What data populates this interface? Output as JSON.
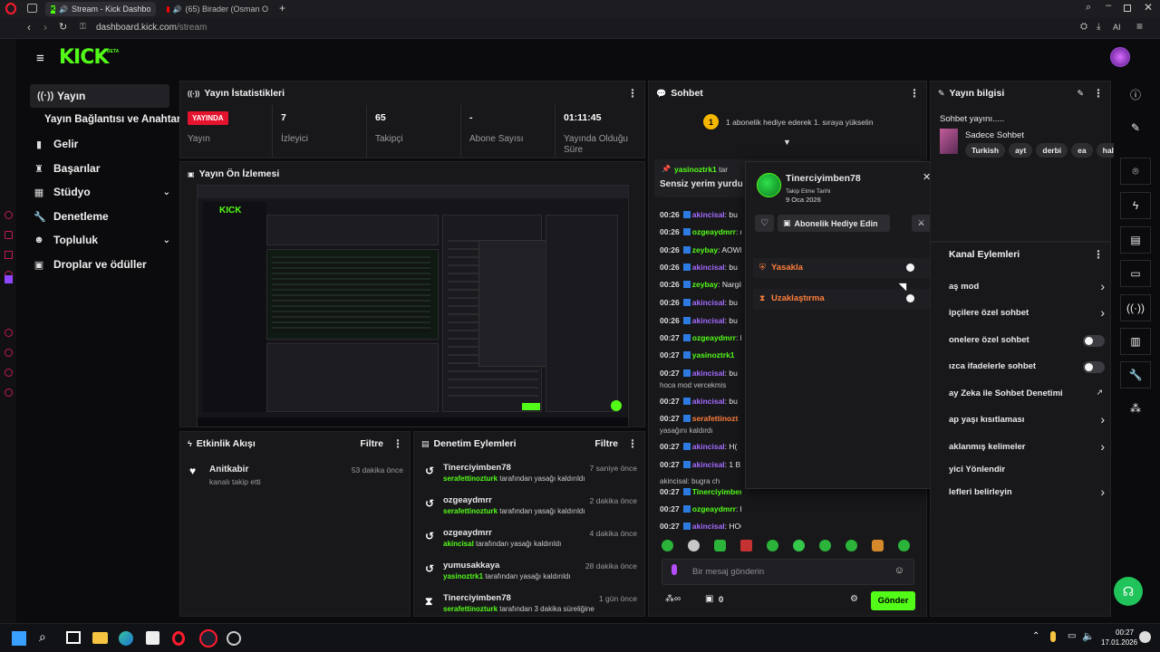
{
  "browser": {
    "tab1": "Stream - Kick Dashbo",
    "tab2": "(65) Birader (Osman O",
    "url_host": "dashboard.kick.com",
    "url_path": "/stream",
    "ai_label": "AI"
  },
  "brand": {
    "logo": "KICK",
    "beta": "BETA"
  },
  "sidebar": {
    "items": [
      {
        "label": "Yayın",
        "icon": "broadcast-icon"
      },
      {
        "label": "Yayın Bağlantısı ve Anahtarı"
      },
      {
        "label": "Gelir",
        "icon": "chart-icon"
      },
      {
        "label": "Başarılar",
        "icon": "trophy-icon"
      },
      {
        "label": "Stüdyo",
        "icon": "studio-icon"
      },
      {
        "label": "Denetleme",
        "icon": "wrench-icon"
      },
      {
        "label": "Topluluk",
        "icon": "community-icon"
      },
      {
        "label": "Droplar ve ödüller",
        "icon": "gift-icon"
      }
    ]
  },
  "stats": {
    "title": "Yayın İstatistikleri",
    "live_badge": "YAYINDA",
    "live_label": "Yayın",
    "viewers": "7",
    "viewers_label": "İzleyici",
    "followers": "65",
    "followers_label": "Takipçi",
    "subs": "-",
    "subs_label": "Abone Sayısı",
    "uptime": "01:11:45",
    "uptime_label": "Yayında Olduğu Süre"
  },
  "preview": {
    "title": "Yayın Ön İzlemesi"
  },
  "activity": {
    "title": "Etkinlik Akışı",
    "filter": "Filtre",
    "items": [
      {
        "user": "Anitkabir",
        "action": "kanalı takip etti",
        "time": "53 dakika önce"
      }
    ]
  },
  "modlog": {
    "title": "Denetim Eylemleri",
    "filter": "Filtre",
    "items": [
      {
        "user": "Tinerciyimben78",
        "by": "serafettinozturk",
        "action": "tarafından yasağı kaldırıldı",
        "time": "7 saniye önce"
      },
      {
        "user": "ozgeaydmrr",
        "by": "serafettinozturk",
        "action": "tarafından yasağı kaldırıldı",
        "time": "2 dakika önce"
      },
      {
        "user": "ozgeaydmrr",
        "by": "akincisal",
        "action": "tarafından yasağı kaldırıldı",
        "time": "4 dakika önce"
      },
      {
        "user": "yumusakkaya",
        "by": "yasinoztrk1",
        "action": "tarafından yasağı kaldırıldı",
        "time": "28 dakika önce"
      },
      {
        "user": "Tinerciyimben78",
        "by": "serafettinozturk",
        "action": "tarafından 3 dakika süreliğine",
        "time": "1 gün önce"
      }
    ]
  },
  "chat": {
    "title": "Sohbet",
    "gift_banner": "1 abonelik hediye ederek 1. sıraya yükselin",
    "gift_rank": "1",
    "pinned_user": "yasinoztrk1",
    "pinned_suffix": "tar",
    "pinned_msg": "Sensiz yerim yurdu",
    "lines": [
      {
        "t": "00:26",
        "u": "akincisal",
        "m": "bu",
        "c": "purple"
      },
      {
        "t": "00:26",
        "u": "ozgeaydmrr",
        "m": "na",
        "c": "green"
      },
      {
        "t": "00:26",
        "u": "zeybay",
        "m": "AOWM",
        "c": "green"
      },
      {
        "t": "00:26",
        "u": "akincisal",
        "m": "bu",
        "c": "purple"
      },
      {
        "t": "00:26",
        "u": "zeybay",
        "m": "Nargile",
        "c": "green"
      },
      {
        "t": "00:26",
        "u": "akincisal",
        "m": "bu",
        "c": "purple"
      },
      {
        "t": "00:26",
        "u": "akincisal",
        "m": "bu",
        "c": "purple"
      },
      {
        "t": "00:27",
        "u": "ozgeaydmrr",
        "m": "he",
        "c": "green"
      },
      {
        "t": "00:27",
        "u": "yasinoztrk1",
        "m": "",
        "c": "green"
      },
      {
        "t": "00:27",
        "u": "akincisal",
        "m": "bu",
        "c": "purple"
      },
      {
        "t": "",
        "u": "",
        "m": "hoca mod vercekmis",
        "c": ""
      },
      {
        "t": "00:27",
        "u": "akincisal",
        "m": "bu",
        "c": "purple"
      },
      {
        "t": "00:27",
        "u": "serafettinozt",
        "m": "",
        "c": "orange"
      },
      {
        "t": "",
        "u": "",
        "m": "yasağını kaldırdı",
        "c": ""
      },
      {
        "t": "00:27",
        "u": "akincisal",
        "m": "H(",
        "c": "purple"
      },
      {
        "t": "00:27",
        "u": "akincisal",
        "m": "1 B",
        "c": "purple"
      },
      {
        "t": "",
        "u": "",
        "m": "akincisal: bugra ch",
        "c": ""
      },
      {
        "t": "00:27",
        "u": "Tinerciyimben7",
        "m": "",
        "c": "green"
      },
      {
        "t": "00:27",
        "u": "ozgeaydmrr",
        "m": "hocam ya",
        "c": "green"
      },
      {
        "t": "00:27",
        "u": "akincisal",
        "m": "HOCAM",
        "c": "purple"
      }
    ],
    "input_placeholder": "Bir mesaj gönderin",
    "points": "0",
    "send": "Gönder"
  },
  "usercard": {
    "name": "Tinerciyimben78",
    "follow_label": "Takip Etme Tarihi",
    "follow_date": "9 Oca 2026",
    "gift_sub": "Abonelik Hediye Edin",
    "ban": "Yasakla",
    "timeout": "Uzaklaştırma"
  },
  "info": {
    "title": "Yayın bilgisi",
    "stream_title": "Sohbet yayını.....",
    "category": "Sadece Sohbet",
    "tags": [
      "Turkish",
      "ayt",
      "derbi",
      "ea",
      "halı"
    ]
  },
  "channel_actions": {
    "title": "Kanal Eylemleri",
    "items": [
      {
        "label": "aş mod",
        "control": "chevron"
      },
      {
        "label": "ipçilere özel sohbet",
        "control": "chevron"
      },
      {
        "label": "onelere özel sohbet",
        "control": "toggle"
      },
      {
        "label": "ızca ifadelerle sohbet",
        "control": "toggle"
      },
      {
        "label": "ay Zeka ile Sohbet Denetimi",
        "control": "external"
      },
      {
        "label": "ap yaşı kısıtlaması",
        "control": "chevron"
      },
      {
        "label": "aklanmış kelimeler",
        "control": "chevron"
      },
      {
        "label": "yici Yönlendir",
        "control": "none"
      },
      {
        "label": "lefleri belirleyin",
        "control": "chevron"
      }
    ]
  },
  "taskbar": {
    "time": "00:27",
    "date": "17.01.2026"
  },
  "colors": {
    "kick_green": "#53fc18",
    "live_red": "#e5142e",
    "panel": "#18181b"
  }
}
